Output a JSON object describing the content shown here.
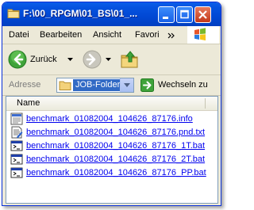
{
  "window": {
    "title": "F:\\00_RPGM\\01_BS\\01_..."
  },
  "menu": {
    "items": [
      "Datei",
      "Bearbeiten",
      "Ansicht",
      "Favori"
    ]
  },
  "toolbar": {
    "back_label": "Zurück"
  },
  "address": {
    "label": "Adresse",
    "value": "JOB-Folder",
    "go_label": "Wechseln zu"
  },
  "filelist": {
    "column_name": "Name",
    "files": [
      {
        "name": "benchmark_01082004_104626_87176.info",
        "icon": "info-file-icon"
      },
      {
        "name": "benchmark_01082004_104626_87176.pnd.txt",
        "icon": "text-file-icon"
      },
      {
        "name": "benchmark_01082004_104626_87176_1T.bat",
        "icon": "batch-file-icon"
      },
      {
        "name": "benchmark_01082004_104626_87176_2T.bat",
        "icon": "batch-file-icon"
      },
      {
        "name": "benchmark_01082004_104626_87176_PP.bat",
        "icon": "batch-file-icon"
      }
    ]
  },
  "colors": {
    "titlebar": "#0148d4",
    "selection": "#316ac5",
    "link": "#0000ee"
  }
}
